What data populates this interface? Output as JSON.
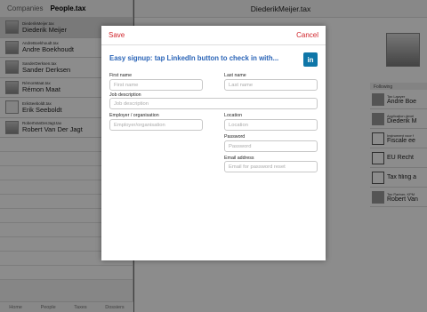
{
  "left": {
    "tabs": [
      "Companies",
      "People.tax"
    ],
    "items": [
      {
        "handle": "DiederikMeijer.tax",
        "name": "Diederik Meijer"
      },
      {
        "handle": "AndreBoekhoudt.tax",
        "name": "Andre Boekhoudt"
      },
      {
        "handle": "SanderDerksen.tax",
        "name": "Sander Derksen"
      },
      {
        "handle": "RémonMaat.tax",
        "name": "Rémon Maat"
      },
      {
        "handle": "ErikSeeboldt.tax",
        "name": "Erik Seeboldt"
      },
      {
        "handle": "RobertVanDerJagt.tax",
        "name": "Robert Van Der Jagt"
      }
    ],
    "bottom_tabs": [
      "Home",
      "People",
      "Taxes",
      "Dossiers"
    ]
  },
  "right": {
    "title": "DiederikMeijer.tax",
    "following_title": "Following",
    "following": [
      {
        "sub": "Tax Lawyer",
        "name": "Andre Boe"
      },
      {
        "sub": "Application devel",
        "name": "Diederik M"
      },
      {
        "sub": "Instrument voor f",
        "name": "Fiscale ee"
      },
      {
        "sub": "",
        "name": "EU Recht"
      },
      {
        "sub": "",
        "name": "Tax filing a"
      },
      {
        "sub": "Tax Partner, KPM",
        "name": "Robert Van"
      }
    ]
  },
  "modal": {
    "save_label": "Save",
    "cancel_label": "Cancel",
    "signup_text": "Easy signup: tap LinkedIn button to check in with...",
    "linkedin_label": "in",
    "fields": {
      "first_name": {
        "label": "First name",
        "placeholder": "First name"
      },
      "last_name": {
        "label": "Last name",
        "placeholder": "Last name"
      },
      "job_description": {
        "label": "Job description",
        "placeholder": "Job description"
      },
      "employer": {
        "label": "Employer / organisation",
        "placeholder": "Employer/organisation"
      },
      "location": {
        "label": "Location",
        "placeholder": "Location"
      },
      "password": {
        "label": "Password",
        "placeholder": "Password"
      },
      "email": {
        "label": "Email address",
        "placeholder": "Email for password reset"
      }
    }
  }
}
